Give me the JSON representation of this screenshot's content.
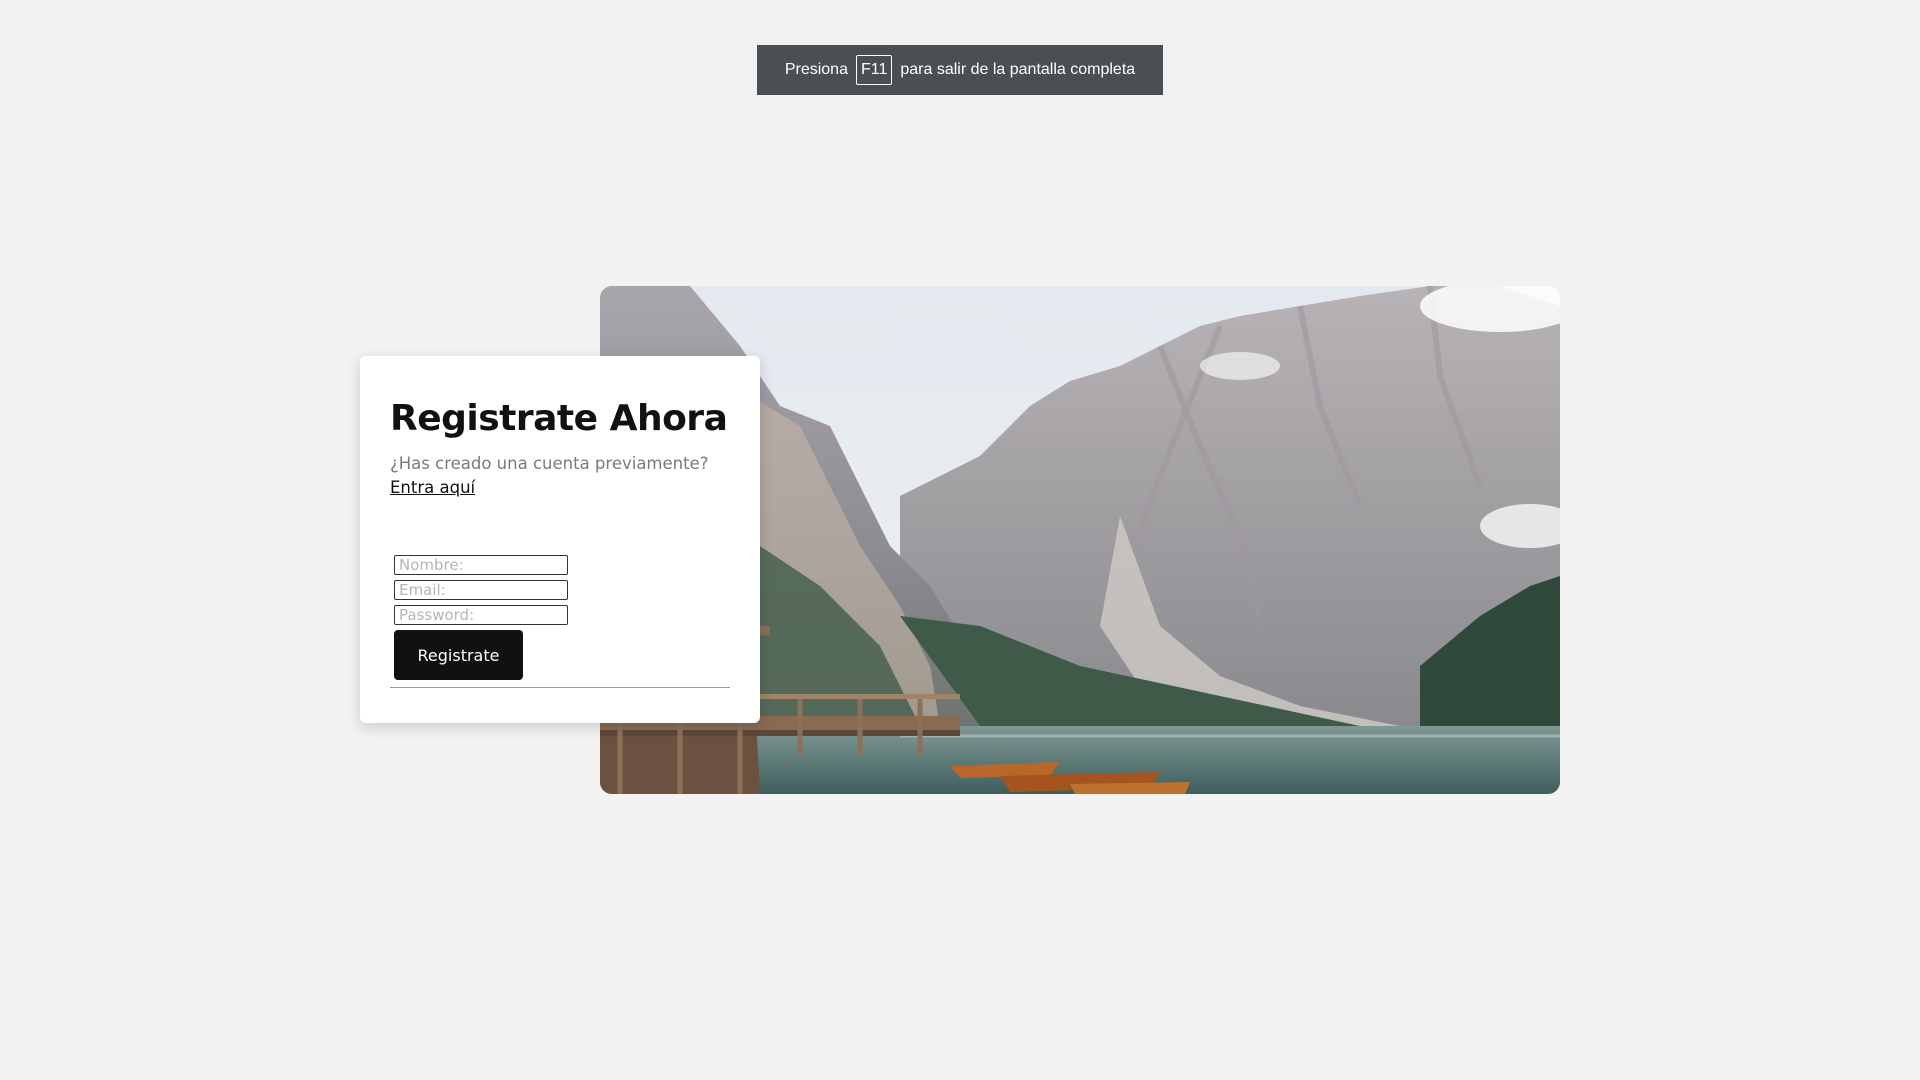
{
  "fullscreen_notice": {
    "before": "Presiona",
    "key": "F11",
    "after": "para salir de la pantalla completa"
  },
  "card": {
    "title": "Registrate Ahora",
    "subtitle": "¿Has creado una cuenta previamente?",
    "login_link": "Entra aquí",
    "fields": {
      "name_placeholder": "Nombre:",
      "email_placeholder": "Email:",
      "password_placeholder": "Password:"
    },
    "submit_label": "Registrate"
  },
  "photo": {
    "icon": "mountain-lake-photo"
  }
}
